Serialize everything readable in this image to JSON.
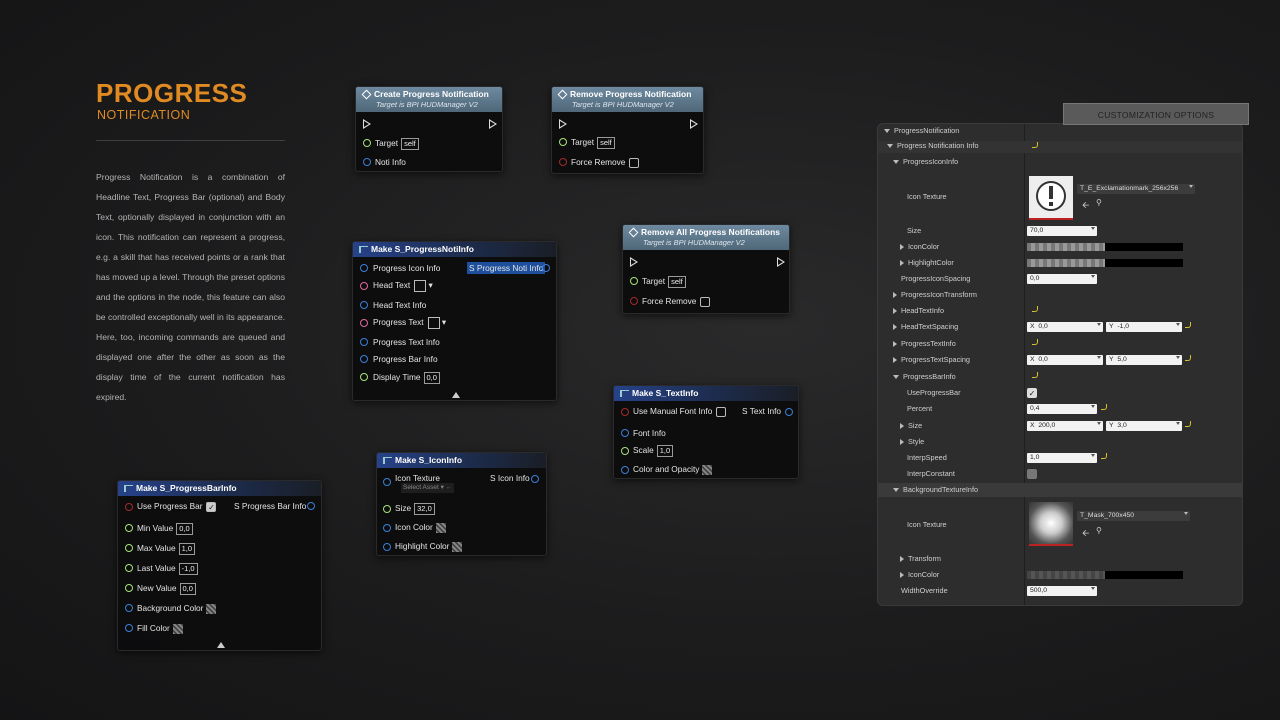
{
  "header": {
    "title": "PROGRESS",
    "subtitle": "NOTIFICATION"
  },
  "description": "Progress Notification is a combination of Headline Text, Progress Bar (optional) and Body Text, optionally displayed in conjunction with an icon. This notification can represent a progress, e.g. a skill that has received points or a rank that has moved up a level. Through the preset options and the options in the node, this feature can also be controlled exceptionally well in its appearance. Here, too, incoming commands are queued and displayed one after the other as soon as the display time of the current notification has expired.",
  "node_create": {
    "title": "Create Progress Notification",
    "subtitle": "Target is BPI HUDManager V2",
    "target_label": "Target",
    "target_value": "self",
    "noti_info_label": "Noti Info"
  },
  "node_remove": {
    "title": "Remove Progress Notification",
    "subtitle": "Target is BPI HUDManager V2",
    "target_label": "Target",
    "target_value": "self",
    "force_remove_label": "Force Remove"
  },
  "node_remove_all": {
    "title": "Remove All Progress Notifications",
    "subtitle": "Target is BPI HUDManager V2",
    "target_label": "Target",
    "target_value": "self",
    "force_remove_label": "Force Remove"
  },
  "node_make_noti": {
    "title": "Make S_ProgressNotiInfo",
    "progress_icon_info": "Progress Icon Info",
    "output": "S Progress Noti Info",
    "head_text": "Head Text",
    "head_text_info": "Head Text Info",
    "progress_text": "Progress Text",
    "progress_text_info": "Progress Text Info",
    "progress_bar_info": "Progress Bar Info",
    "display_time": "Display Time",
    "display_time_value": "0,0"
  },
  "node_make_text": {
    "title": "Make S_TextInfo",
    "use_manual_font": "Use Manual Font Info",
    "output": "S Text Info",
    "font_info": "Font Info",
    "scale": "Scale",
    "scale_value": "1,0",
    "color_opacity": "Color and Opacity"
  },
  "node_make_icon": {
    "title": "Make S_IconInfo",
    "icon_texture": "Icon Texture",
    "select_asset": "Select Asset",
    "output": "S Icon Info",
    "size": "Size",
    "size_value": "32,0",
    "icon_color": "Icon Color",
    "highlight_color": "Highlight Color"
  },
  "node_make_bar": {
    "title": "Make S_ProgressBarInfo",
    "use_progress_bar": "Use Progress Bar",
    "output": "S Progress Bar Info",
    "min_value": "Min Value",
    "min_value_v": "0,0",
    "max_value": "Max Value",
    "max_value_v": "1,0",
    "last_value": "Last Value",
    "last_value_v": "-1,0",
    "new_value": "New Value",
    "new_value_v": "0,0",
    "background_color": "Background Color",
    "fill_color": "Fill Color"
  },
  "panel": {
    "tab": "CUSTOMIZATION OPTIONS",
    "root": "ProgressNotification",
    "info": "Progress Notification Info",
    "icon_info": "ProgressIconInfo",
    "icon_texture_label": "Icon Texture",
    "icon_texture_asset": "T_E_Exclamationmark_256x256",
    "size_label": "Size",
    "size_value": "70,0",
    "icon_color_label": "IconColor",
    "highlight_color_label": "HighlightColor",
    "icon_spacing_label": "ProgressIconSpacing",
    "icon_spacing_value": "0,0",
    "icon_transform_label": "ProgressIconTransform",
    "head_text_info_label": "HeadTextInfo",
    "head_text_spacing_label": "HeadTextSpacing",
    "head_x": "0,0",
    "head_y": "-1,0",
    "progress_text_info_label": "ProgressTextInfo",
    "progress_text_spacing_label": "ProgressTextSpacing",
    "pts_x": "0,0",
    "pts_y": "5,0",
    "bar_info_label": "ProgressBarInfo",
    "use_bar_label": "UseProgressBar",
    "percent_label": "Percent",
    "percent_value": "0,4",
    "bar_size_label": "Size",
    "bar_x": "200,0",
    "bar_y": "3,0",
    "style_label": "Style",
    "interp_speed_label": "InterpSpeed",
    "interp_speed_value": "1,0",
    "interp_constant_label": "InterpConstant",
    "bg_texture_info_label": "BackgroundTextureInfo",
    "bg_icon_texture_label": "Icon Texture",
    "bg_texture_asset": "T_Mask_700x450",
    "transform_label": "Transform",
    "bg_icon_color_label": "IconColor",
    "width_override_label": "WidthOverride",
    "width_override_value": "500,0",
    "x": "X",
    "y": "Y"
  },
  "colors": {
    "accent": "#e08a22"
  }
}
